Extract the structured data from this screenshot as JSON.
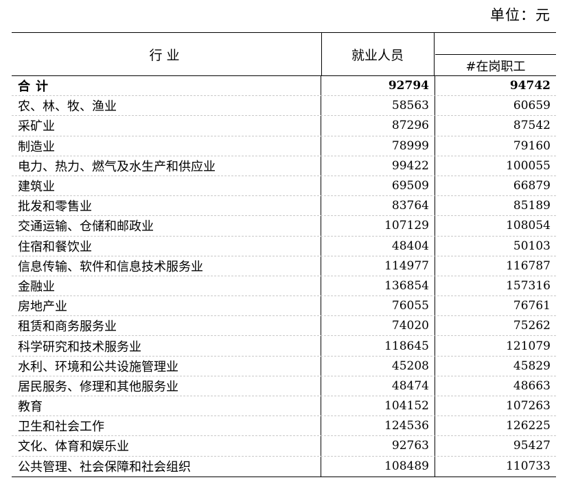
{
  "unit_label": "单位：元",
  "header": {
    "industry": "行业",
    "employed": "就业人员",
    "on_post": "#在岗职工"
  },
  "total": {
    "name": "合计",
    "employed": "92794",
    "on_post": "94742"
  },
  "rows": [
    {
      "name": "农、林、牧、渔业",
      "employed": "58563",
      "on_post": "60659"
    },
    {
      "name": "采矿业",
      "employed": "87296",
      "on_post": "87542"
    },
    {
      "name": "制造业",
      "employed": "78999",
      "on_post": "79160"
    },
    {
      "name": "电力、热力、燃气及水生产和供应业",
      "employed": "99422",
      "on_post": "100055"
    },
    {
      "name": "建筑业",
      "employed": "69509",
      "on_post": "66879"
    },
    {
      "name": "批发和零售业",
      "employed": "83764",
      "on_post": "85189"
    },
    {
      "name": "交通运输、仓储和邮政业",
      "employed": "107129",
      "on_post": "108054"
    },
    {
      "name": "住宿和餐饮业",
      "employed": "48404",
      "on_post": "50103"
    },
    {
      "name": "信息传输、软件和信息技术服务业",
      "employed": "114977",
      "on_post": "116787"
    },
    {
      "name": "金融业",
      "employed": "136854",
      "on_post": "157316"
    },
    {
      "name": "房地产业",
      "employed": "76055",
      "on_post": "76761"
    },
    {
      "name": "租赁和商务服务业",
      "employed": "74020",
      "on_post": "75262"
    },
    {
      "name": "科学研究和技术服务业",
      "employed": "118645",
      "on_post": "121079"
    },
    {
      "name": "水利、环境和公共设施管理业",
      "employed": "45208",
      "on_post": "45829"
    },
    {
      "name": "居民服务、修理和其他服务业",
      "employed": "48474",
      "on_post": "48663"
    },
    {
      "name": "教育",
      "employed": "104152",
      "on_post": "107263"
    },
    {
      "name": "卫生和社会工作",
      "employed": "124536",
      "on_post": "126225"
    },
    {
      "name": "文化、体育和娱乐业",
      "employed": "92763",
      "on_post": "95427"
    },
    {
      "name": "公共管理、社会保障和社会组织",
      "employed": "108489",
      "on_post": "110733"
    }
  ]
}
